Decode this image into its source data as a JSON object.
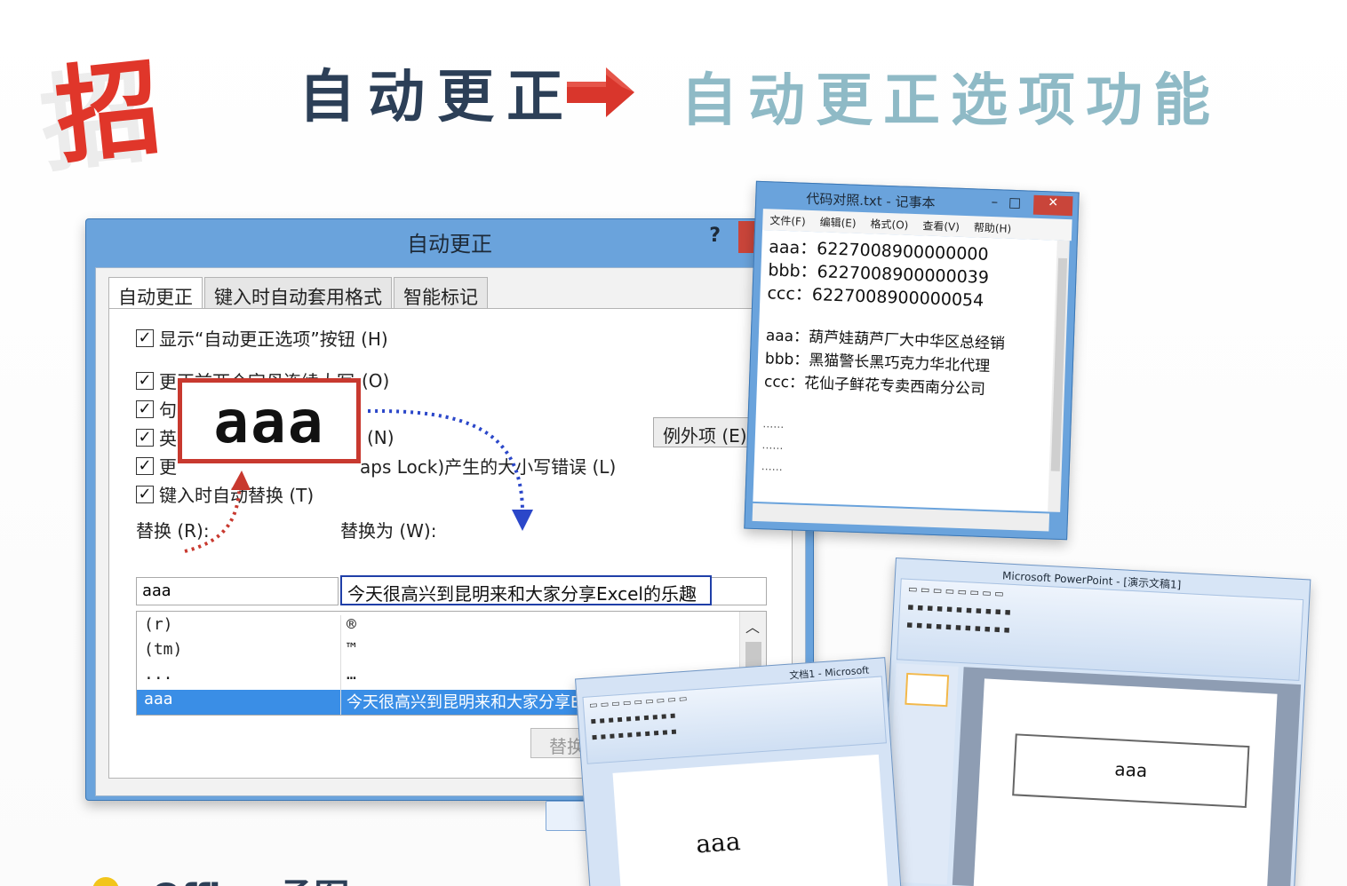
{
  "header": {
    "logo_char": "招",
    "title_left": "自动更正",
    "title_right": "自动更正选项功能",
    "colors": {
      "logo": "#e0362a",
      "left": "#2c3f57",
      "right": "#8fbac6",
      "arrow": "#d9362c"
    }
  },
  "dialog": {
    "title": "自动更正",
    "help": "?",
    "tabs": [
      "自动更正",
      "键入时自动套用格式",
      "智能标记"
    ],
    "options": {
      "show_buttons": "显示“自动更正选项”按钮 (H)",
      "two_initials_start": "更正前两个字母连续大写",
      "two_initials_key": "(O)",
      "sentence_prefix": "句",
      "english_prefix": "英",
      "english_key": "(N)",
      "capslock_prefix": "更",
      "capslock_tail": "aps Lock)产生的大小写错误 (L)",
      "replace_as_type": "键入时自动替换 (T)"
    },
    "exceptions_button": "例外项 (E)...",
    "replace_label": "替换 (R):",
    "with_label": "替换为 (W):",
    "replace_value": "aaa",
    "with_value": "今天很高兴到昆明来和大家分享Excel的乐趣",
    "entries": [
      {
        "from": "(r)",
        "to": "®"
      },
      {
        "from": "(tm)",
        "to": "™"
      },
      {
        "from": "...",
        "to": "…"
      },
      {
        "from": "aaa",
        "to": "今天很高兴到昆明来和大家分享Excel的乐趣"
      }
    ],
    "replace_button": "替换"
  },
  "callout": {
    "text": "aaa"
  },
  "notepad": {
    "title": "代码对照.txt - 记事本",
    "menu": [
      "文件(F)",
      "编辑(E)",
      "格式(O)",
      "查看(V)",
      "帮助(H)"
    ],
    "lines_numbers": [
      "aaa：6227008900000000",
      "bbb：6227008900000039",
      "ccc：6227008900000054"
    ],
    "lines_names": [
      "aaa：葫芦娃葫芦厂大中华区总经销",
      "bbb：黑猫警长黑巧克力华北代理",
      "ccc：花仙子鲜花专卖西南分公司"
    ],
    "dots": [
      "……",
      "……",
      "……"
    ]
  },
  "powerpoint": {
    "title": "Microsoft PowerPoint - [演示文稿1]",
    "slide_text": "aaa"
  },
  "word": {
    "title": "文档1 - Microsoft",
    "page_text": "aaa"
  },
  "bottom": {
    "text": "Office 承图"
  }
}
